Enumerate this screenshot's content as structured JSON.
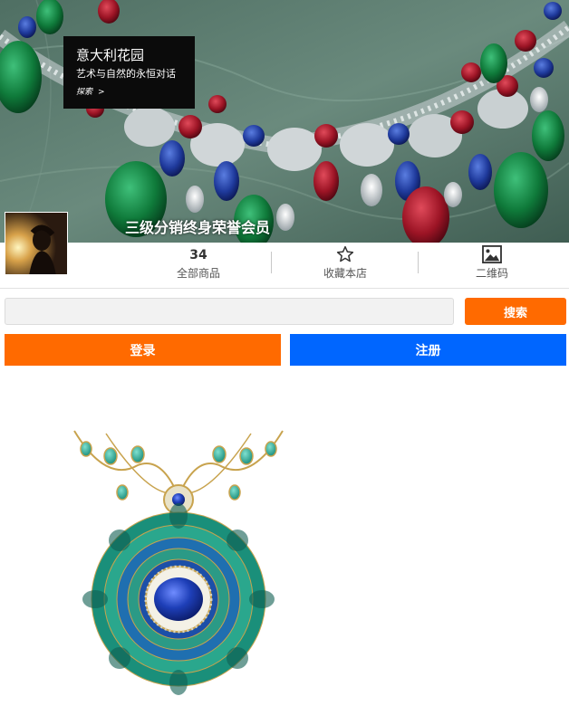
{
  "banner": {
    "promo_title": "意大利花园",
    "promo_subtitle": "艺术与自然的永恒对话",
    "promo_link": "探索",
    "promo_link_arrow": ">",
    "store_name": "三级分销终身荣誉会员"
  },
  "stats": {
    "goods_count": "34",
    "goods_label": "全部商品",
    "favorite_label": "收藏本店",
    "favorite_icon": "star-icon",
    "qr_label": "二维码",
    "qr_icon": "image-icon"
  },
  "search": {
    "placeholder": "",
    "button_label": "搜索"
  },
  "auth": {
    "login_label": "登录",
    "register_label": "注册"
  },
  "colors": {
    "orange": "#ff6a00",
    "blue": "#0066ff"
  }
}
